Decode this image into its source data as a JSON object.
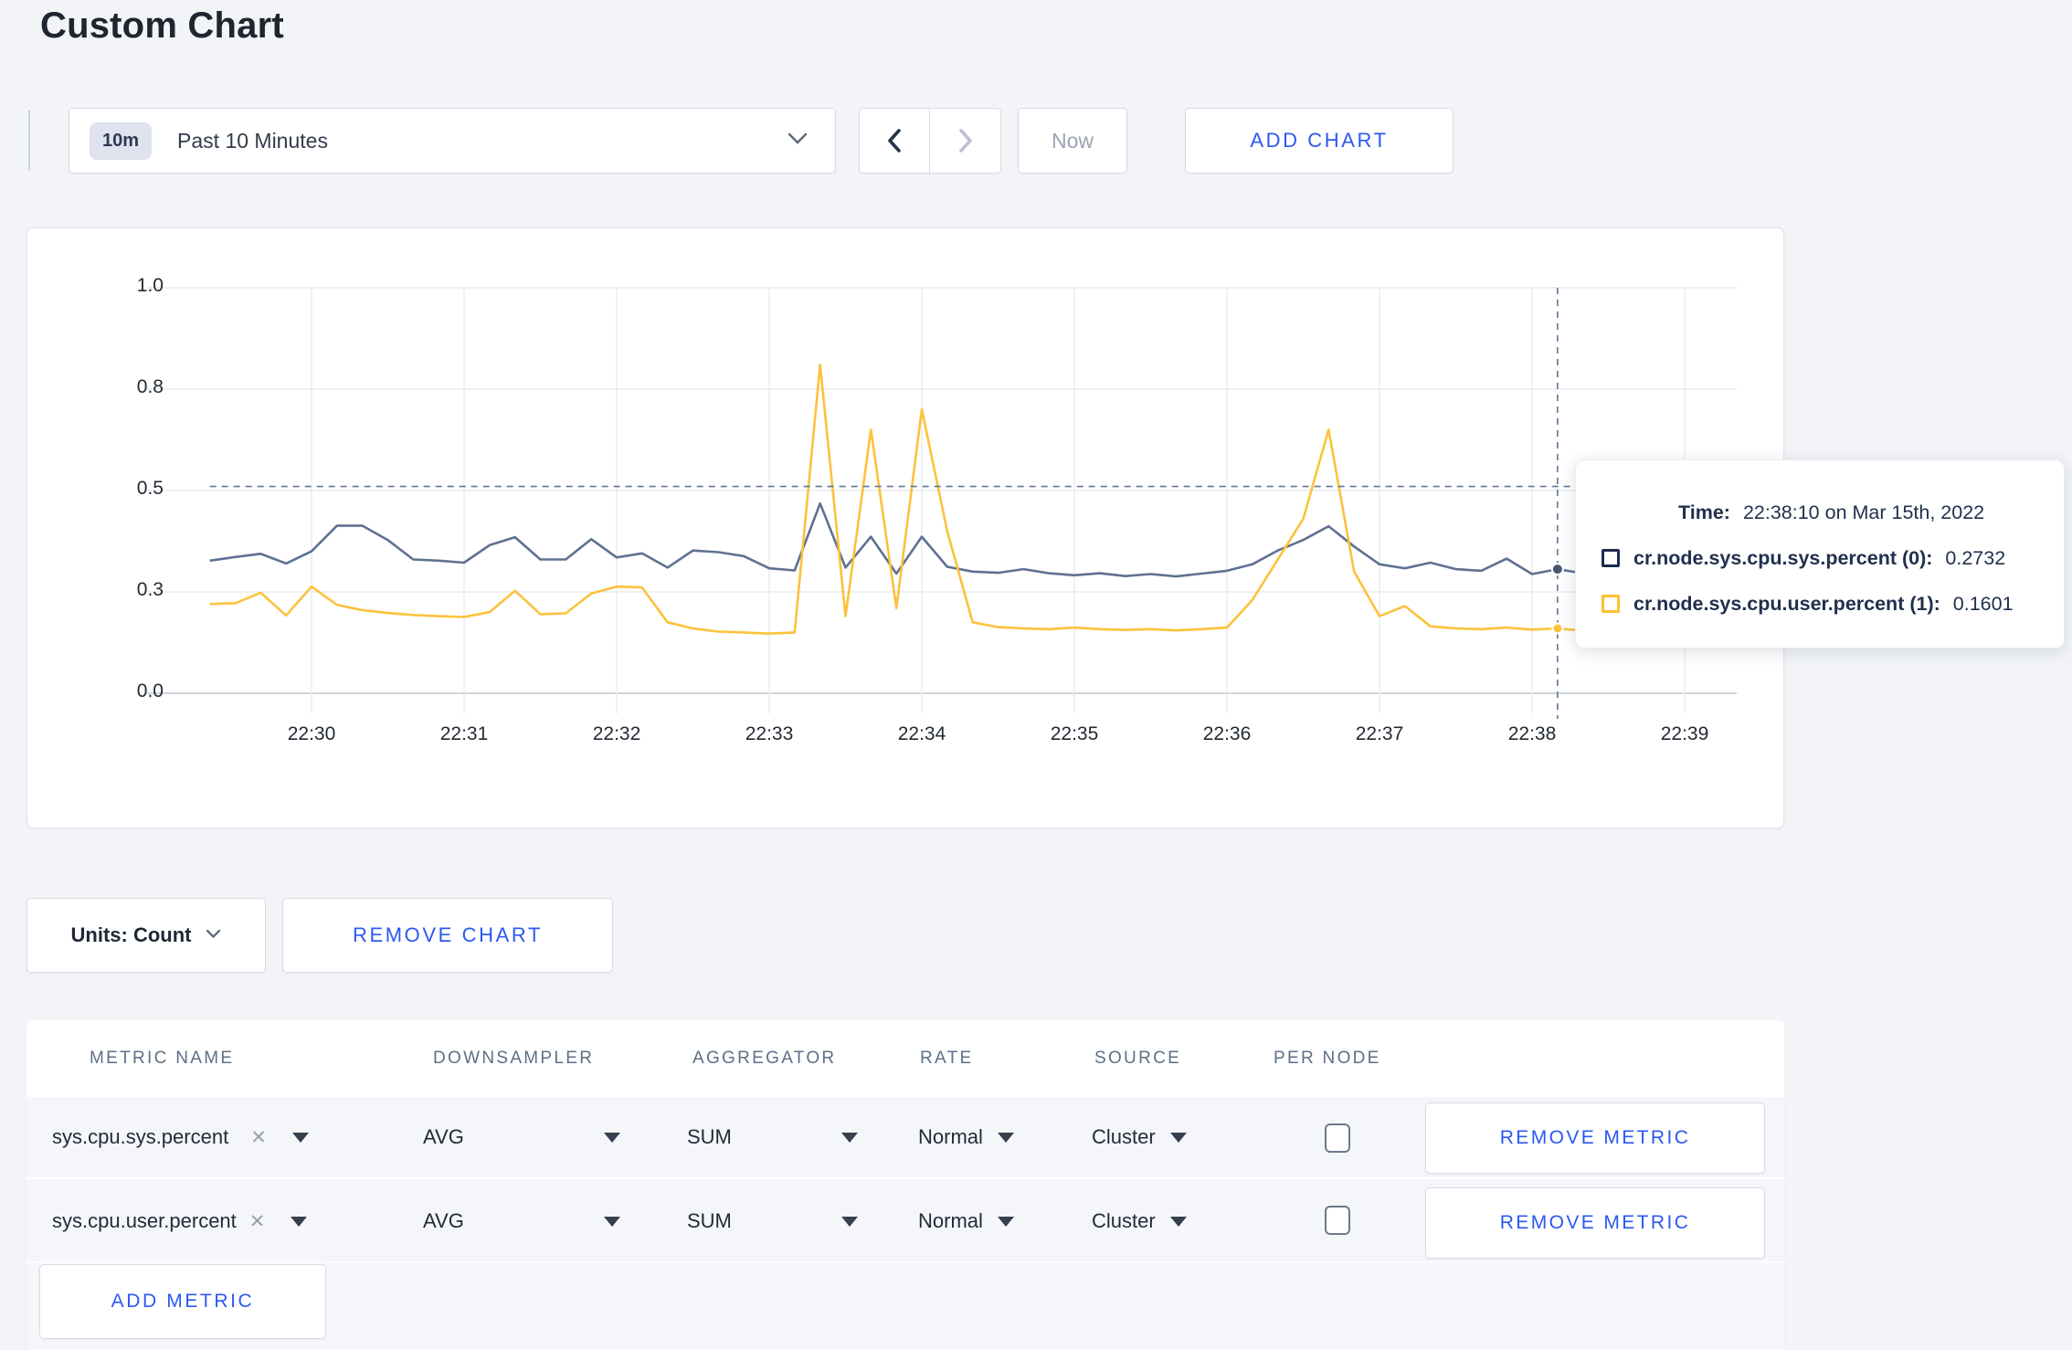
{
  "header": {
    "title": "Custom Chart"
  },
  "toolbar": {
    "range_badge": "10m",
    "range_label": "Past 10 Minutes",
    "now_label": "Now",
    "add_chart_label": "ADD CHART"
  },
  "chart": {
    "tooltip": {
      "time_label": "Time:",
      "time_value": "22:38:10 on Mar 15th, 2022",
      "rows": [
        {
          "label": "cr.node.sys.cpu.sys.percent (0):",
          "value": "0.2732",
          "color": "#1b2c4f"
        },
        {
          "label": "cr.node.sys.cpu.user.percent (1):",
          "value": "0.1601",
          "color": "#fdc02f"
        }
      ]
    }
  },
  "chart_data": {
    "type": "line",
    "title": "",
    "xlabel": "",
    "ylabel": "",
    "ylim": [
      0,
      1
    ],
    "grid": true,
    "x_start_time": "22:29:20",
    "x_interval_seconds": 10,
    "y_ticks": [
      {
        "label": "0.0",
        "value": 0.0
      },
      {
        "label": "0.3",
        "value": 0.25
      },
      {
        "label": "0.5",
        "value": 0.5
      },
      {
        "label": "0.8",
        "value": 0.75
      },
      {
        "label": "1.0",
        "value": 1.0
      }
    ],
    "x_ticks": [
      {
        "label": "22:30",
        "offset_seconds": 40
      },
      {
        "label": "22:31",
        "offset_seconds": 100
      },
      {
        "label": "22:32",
        "offset_seconds": 160
      },
      {
        "label": "22:33",
        "offset_seconds": 220
      },
      {
        "label": "22:34",
        "offset_seconds": 280
      },
      {
        "label": "22:35",
        "offset_seconds": 340
      },
      {
        "label": "22:36",
        "offset_seconds": 400
      },
      {
        "label": "22:37",
        "offset_seconds": 460
      },
      {
        "label": "22:38",
        "offset_seconds": 520
      },
      {
        "label": "22:39",
        "offset_seconds": 580
      }
    ],
    "series": [
      {
        "name": "cr.node.sys.cpu.sys.percent",
        "color": "#5e7192",
        "values": [
          0.327,
          0.336,
          0.344,
          0.32,
          0.35,
          0.413,
          0.413,
          0.378,
          0.33,
          0.327,
          0.322,
          0.365,
          0.385,
          0.33,
          0.33,
          0.38,
          0.335,
          0.345,
          0.31,
          0.352,
          0.348,
          0.338,
          0.308,
          0.303,
          0.468,
          0.31,
          0.386,
          0.295,
          0.386,
          0.312,
          0.3,
          0.297,
          0.306,
          0.296,
          0.291,
          0.296,
          0.289,
          0.294,
          0.288,
          0.295,
          0.302,
          0.318,
          0.352,
          0.378,
          0.412,
          0.362,
          0.318,
          0.308,
          0.322,
          0.306,
          0.302,
          0.332,
          0.294,
          0.306,
          0.296,
          0.316,
          0.318,
          0.3,
          0.298,
          0.292,
          0.288
        ]
      },
      {
        "name": "cr.node.sys.cpu.user.percent",
        "color": "#fcc23c",
        "values": [
          0.22,
          0.222,
          0.248,
          0.192,
          0.263,
          0.218,
          0.205,
          0.198,
          0.193,
          0.19,
          0.188,
          0.2,
          0.253,
          0.195,
          0.197,
          0.246,
          0.263,
          0.261,
          0.175,
          0.16,
          0.152,
          0.15,
          0.147,
          0.15,
          0.81,
          0.19,
          0.65,
          0.21,
          0.7,
          0.4,
          0.175,
          0.163,
          0.16,
          0.158,
          0.162,
          0.158,
          0.156,
          0.158,
          0.155,
          0.158,
          0.162,
          0.23,
          0.33,
          0.43,
          0.65,
          0.3,
          0.19,
          0.215,
          0.165,
          0.16,
          0.158,
          0.162,
          0.157,
          0.16,
          0.154,
          0.15,
          0.147,
          0.15,
          0.152,
          0.28,
          0.245
        ]
      }
    ],
    "hover": {
      "index": 53,
      "time": "22:38:10 on Mar 15th, 2022",
      "values": [
        0.2732,
        0.1601
      ],
      "crosshair_y_value": 0.51
    },
    "legend_position": "tooltip"
  },
  "units": {
    "label": "Units: Count",
    "remove_chart_label": "REMOVE CHART"
  },
  "table": {
    "headers": [
      "METRIC NAME",
      "DOWNSAMPLER",
      "AGGREGATOR",
      "RATE",
      "SOURCE",
      "PER NODE"
    ],
    "rows": [
      {
        "metric": "sys.cpu.sys.percent",
        "downsampler": "AVG",
        "aggregator": "SUM",
        "rate": "Normal",
        "source": "Cluster",
        "per_node_checked": false,
        "action": "REMOVE METRIC"
      },
      {
        "metric": "sys.cpu.user.percent",
        "downsampler": "AVG",
        "aggregator": "SUM",
        "rate": "Normal",
        "source": "Cluster",
        "per_node_checked": false,
        "action": "REMOVE METRIC"
      }
    ],
    "add_metric_label": "ADD METRIC"
  }
}
